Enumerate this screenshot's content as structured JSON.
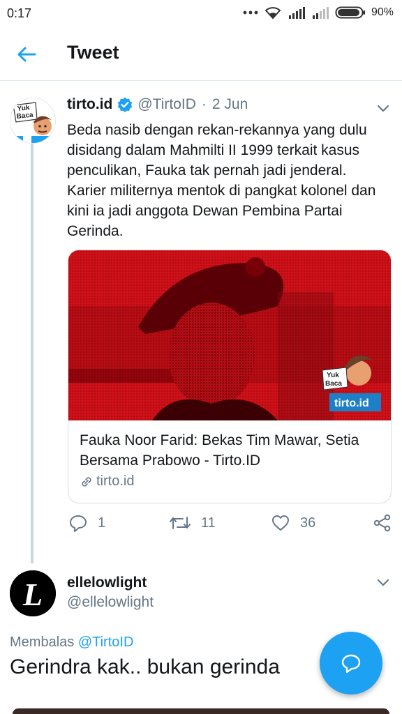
{
  "status_bar": {
    "time": "0:17",
    "battery_percent": "90%",
    "icons": [
      "more-dots-icon",
      "wifi-icon",
      "signal-icon",
      "signal-icon",
      "battery-icon"
    ]
  },
  "header": {
    "title": "Tweet",
    "back_icon": "arrow-left-icon"
  },
  "tweet": {
    "author_name": "tirto.id",
    "verified": true,
    "handle": "@TirtoID",
    "separator": "·",
    "date": "2 Jun",
    "avatar_text_1": "Yuk",
    "avatar_text_2": "Baca",
    "text": "Beda nasib dengan rekan-rekannya yang dulu disidang dalam Mahmilti II 1999 terkait kasus penculikan, Fauka tak pernah jadi jenderal. Karier militernya mentok di pangkat kolonel dan kini ia jadi anggota Dewan Pembina Partai Gerinda.",
    "card": {
      "title": "Fauka Noor Farid: Bekas Tim Mawar, Setia Bersama Prabowo - Tirto.ID",
      "domain": "tirto.id",
      "badge_text_1": "Yuk",
      "badge_text_2": "Baca",
      "badge_logo": "tirto.id"
    },
    "actions": {
      "replies": "1",
      "retweets": "11",
      "likes": "36"
    }
  },
  "reply": {
    "author_name": "ellelowlight",
    "handle": "@ellelowlight",
    "replying_prefix": "Membalas",
    "replying_to": "@TirtoID",
    "text": "Gerindra kak.. bukan gerinda",
    "avatar_glyph": "L"
  },
  "colors": {
    "accent": "#1da1f2",
    "secondary_text": "#657786",
    "card_image_red": "#c8101a"
  }
}
